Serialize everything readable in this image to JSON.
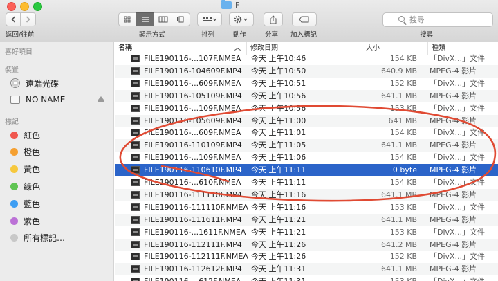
{
  "window": {
    "title": "F"
  },
  "toolbar": {
    "back_forward_label": "返回/往前",
    "view_label": "顯示方式",
    "sort_label": "排列",
    "action_label": "動作",
    "share_label": "分享",
    "tag_label": "加入標記",
    "search_label": "搜尋",
    "search_placeholder": "搜尋"
  },
  "sidebar": {
    "favorites_header": "喜好項目",
    "devices_header": "裝置",
    "devices": [
      {
        "label": "遠端光碟"
      },
      {
        "label": "NO NAME"
      }
    ],
    "tags_header": "標記",
    "tags": [
      {
        "label": "紅色",
        "color": "#f0574e"
      },
      {
        "label": "橙色",
        "color": "#f5a031"
      },
      {
        "label": "黃色",
        "color": "#f6c83d"
      },
      {
        "label": "綠色",
        "color": "#5fc452"
      },
      {
        "label": "藍色",
        "color": "#3e9ef3"
      },
      {
        "label": "紫色",
        "color": "#bb71d6"
      },
      {
        "label": "所有標記…",
        "color": "#c8c8c8"
      }
    ]
  },
  "columns": {
    "name": "名稱",
    "date": "修改日期",
    "size": "大小",
    "kind": "種類"
  },
  "rows": [
    {
      "name": "FILE190116-...107F.NMEA",
      "date": "今天 上午10:46",
      "size": "154 KB",
      "kind": "「DivX...」文件"
    },
    {
      "name": "FILE190116-104609F.MP4",
      "date": "今天 上午10:50",
      "size": "640.9 MB",
      "kind": "MPEG-4 影片"
    },
    {
      "name": "FILE190116-...609F.NMEA",
      "date": "今天 上午10:51",
      "size": "152 KB",
      "kind": "「DivX...」文件"
    },
    {
      "name": "FILE190116-105109F.MP4",
      "date": "今天 上午10:56",
      "size": "641.1 MB",
      "kind": "MPEG-4 影片"
    },
    {
      "name": "FILE190116-...109F.NMEA",
      "date": "今天 上午10:56",
      "size": "153 KB",
      "kind": "「DivX...」文件"
    },
    {
      "name": "FILE190116-105609F.MP4",
      "date": "今天 上午11:00",
      "size": "641 MB",
      "kind": "MPEG-4 影片"
    },
    {
      "name": "FILE190116-...609F.NMEA",
      "date": "今天 上午11:01",
      "size": "154 KB",
      "kind": "「DivX...」文件"
    },
    {
      "name": "FILE190116-110109F.MP4",
      "date": "今天 上午11:05",
      "size": "641.1 MB",
      "kind": "MPEG-4 影片"
    },
    {
      "name": "FILE190116-...109F.NMEA",
      "date": "今天 上午11:06",
      "size": "154 KB",
      "kind": "「DivX...」文件"
    },
    {
      "name": "FILE190116-110610F.MP4",
      "date": "今天 上午11:11",
      "size": "0 byte",
      "kind": "MPEG-4 影片",
      "selected": true
    },
    {
      "name": "FILE190116-...610F.NMEA",
      "date": "今天 上午11:11",
      "size": "154 KB",
      "kind": "「DivX...」文件"
    },
    {
      "name": "FILE190116-111110F.MP4",
      "date": "今天 上午11:16",
      "size": "641.1 MB",
      "kind": "MPEG-4 影片"
    },
    {
      "name": "FILE190116-111110F.NMEA",
      "date": "今天 上午11:16",
      "size": "153 KB",
      "kind": "「DivX...」文件"
    },
    {
      "name": "FILE190116-111611F.MP4",
      "date": "今天 上午11:21",
      "size": "641.1 MB",
      "kind": "MPEG-4 影片"
    },
    {
      "name": "FILE190116-...1611F.NMEA",
      "date": "今天 上午11:21",
      "size": "153 KB",
      "kind": "「DivX...」文件"
    },
    {
      "name": "FILE190116-112111F.MP4",
      "date": "今天 上午11:26",
      "size": "641.2 MB",
      "kind": "MPEG-4 影片"
    },
    {
      "name": "FILE190116-112111F.NMEA",
      "date": "今天 上午11:26",
      "size": "152 KB",
      "kind": "「DivX...」文件"
    },
    {
      "name": "FILE190116-112612F.MP4",
      "date": "今天 上午11:31",
      "size": "641.1 MB",
      "kind": "MPEG-4 影片"
    },
    {
      "name": "FILE190116-...612F.NMEA",
      "date": "今天 上午11:31",
      "size": "153 KB",
      "kind": "「DivX...」文件"
    }
  ],
  "annotation": {
    "color": "#e04a33"
  }
}
